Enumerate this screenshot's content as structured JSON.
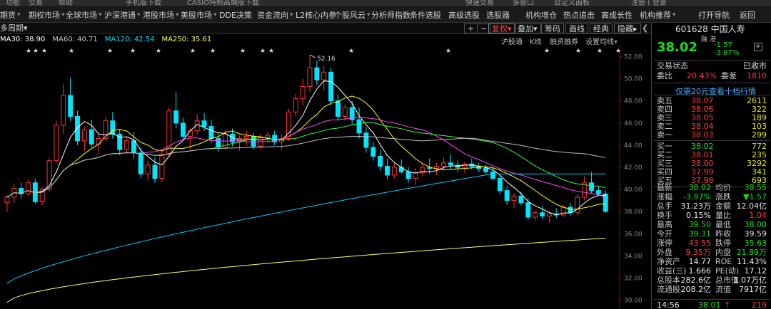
{
  "topbar": {
    "items": [
      "功能",
      "交易",
      "帮助",
      "手机版下载",
      "CASIO特制高端版下载",
      "快速交易",
      "多窗口",
      "自定义面板",
      "注册 | 登录"
    ]
  },
  "menu": {
    "items": [
      {
        "label": "期货",
        "arrow": true
      },
      {
        "label": "期权市场",
        "arrow": true
      },
      {
        "label": "全球市场",
        "arrow": true
      },
      {
        "label": "沪深港通",
        "arrow": true
      },
      {
        "label": "港股市场",
        "arrow": true
      },
      {
        "label": "美股市场",
        "arrow": true
      },
      {
        "label": "DDE决策",
        "arrow": false
      },
      {
        "label": "资金流向",
        "arrow": true
      },
      {
        "label": "L2核心内参",
        "arrow": false
      },
      {
        "label": "个股风云",
        "arrow": true
      },
      {
        "label": "分析师指数",
        "arrow": false
      },
      {
        "label": "条件选股",
        "arrow": false
      },
      {
        "label": "高级选股",
        "arrow": false
      },
      {
        "label": "选股器",
        "arrow": false
      },
      {
        "label": "机构增仓",
        "arrow": false
      },
      {
        "label": "热点追击",
        "arrow": false
      },
      {
        "label": "高成长性",
        "arrow": false
      },
      {
        "label": "机构推荐",
        "arrow": true
      },
      {
        "label": "打开导航",
        "arrow": false
      },
      {
        "label": "返回",
        "arrow": false
      }
    ]
  },
  "toolbar": {
    "period": "多周期",
    "period_arrow": "▾",
    "plus": "+",
    "minus": "−",
    "fq_label": "复权",
    "stack_label": "叠加",
    "chip_label": "筹码",
    "draw_label": "画线",
    "classic_label": "经典",
    "hide_label": "隐藏"
  },
  "subtabs": [
    "沪股通",
    "K线",
    "融资融券",
    "设置均线"
  ],
  "ma_legend": {
    "items": [
      {
        "label": "MA30: 38.90",
        "color": "#ffffff"
      },
      {
        "label": "MA60: 40.71",
        "color": "#c8c8c8"
      },
      {
        "label": "MA120: 42.54",
        "color": "#00e5ff"
      },
      {
        "label": "MA250: 35.61",
        "color": "#ffff66"
      }
    ]
  },
  "chart_data": {
    "type": "candlestick",
    "y_ticks": [
      "52.00",
      "50.00",
      "48.00",
      "46.00",
      "44.00",
      "42.00",
      "40.00",
      "38.00",
      "36.00",
      "34.00",
      "32.00",
      "30.00"
    ],
    "ylim": [
      29.2,
      53.0
    ],
    "high_annotation": "52.16",
    "candles": [
      [
        38.8,
        39.5,
        38.0,
        39.3
      ],
      [
        39.3,
        40.5,
        38.8,
        40.1
      ],
      [
        40.1,
        40.6,
        39.2,
        39.6
      ],
      [
        39.6,
        40.9,
        39.4,
        40.6
      ],
      [
        40.6,
        41.0,
        38.7,
        38.9
      ],
      [
        38.9,
        40.2,
        38.6,
        40.0
      ],
      [
        40.0,
        42.8,
        39.8,
        42.6
      ],
      [
        42.6,
        46.2,
        42.4,
        45.8
      ],
      [
        45.8,
        49.5,
        45.0,
        48.5
      ],
      [
        48.5,
        50.1,
        46.2,
        46.6
      ],
      [
        46.6,
        47.1,
        44.0,
        44.4
      ],
      [
        44.4,
        45.7,
        43.5,
        45.4
      ],
      [
        45.4,
        46.3,
        43.8,
        44.1
      ],
      [
        44.1,
        45.0,
        43.2,
        44.6
      ],
      [
        44.6,
        46.5,
        44.4,
        46.2
      ],
      [
        46.2,
        47.0,
        44.6,
        45.0
      ],
      [
        45.0,
        45.4,
        43.1,
        43.6
      ],
      [
        43.6,
        44.8,
        43.2,
        44.4
      ],
      [
        44.4,
        45.2,
        42.8,
        43.3
      ],
      [
        43.3,
        43.8,
        41.0,
        41.4
      ],
      [
        41.4,
        42.6,
        40.8,
        42.2
      ],
      [
        42.2,
        42.9,
        40.6,
        41.0
      ],
      [
        41.0,
        43.5,
        40.7,
        43.2
      ],
      [
        43.2,
        47.4,
        43.0,
        47.1
      ],
      [
        47.1,
        48.8,
        45.5,
        46.0
      ],
      [
        46.0,
        46.5,
        44.4,
        44.8
      ],
      [
        44.8,
        45.6,
        43.6,
        45.3
      ],
      [
        45.3,
        46.8,
        44.9,
        46.2
      ],
      [
        46.2,
        46.9,
        45.3,
        45.7
      ],
      [
        45.7,
        46.3,
        44.2,
        44.6
      ],
      [
        44.6,
        45.2,
        43.4,
        43.8
      ],
      [
        43.8,
        45.4,
        43.6,
        45.0
      ],
      [
        45.0,
        45.5,
        43.9,
        44.3
      ],
      [
        44.3,
        44.9,
        43.5,
        44.6
      ],
      [
        44.6,
        45.3,
        44.0,
        44.8
      ],
      [
        44.8,
        45.1,
        43.6,
        43.9
      ],
      [
        43.9,
        45.0,
        43.7,
        44.7
      ],
      [
        44.7,
        45.2,
        44.2,
        44.9
      ],
      [
        44.9,
        45.3,
        44.0,
        44.3
      ],
      [
        44.3,
        45.0,
        43.6,
        44.6
      ],
      [
        44.6,
        47.3,
        44.4,
        47.0
      ],
      [
        47.0,
        48.6,
        46.6,
        48.2
      ],
      [
        48.2,
        50.0,
        47.6,
        49.3
      ],
      [
        49.3,
        52.16,
        48.8,
        51.0
      ],
      [
        51.0,
        51.6,
        49.4,
        49.9
      ],
      [
        49.9,
        51.2,
        48.9,
        50.6
      ],
      [
        50.6,
        51.0,
        47.6,
        48.0
      ],
      [
        48.0,
        48.5,
        46.2,
        46.6
      ],
      [
        46.6,
        47.7,
        46.2,
        47.4
      ],
      [
        47.4,
        48.0,
        45.9,
        46.3
      ],
      [
        46.3,
        47.4,
        44.6,
        45.1
      ],
      [
        45.1,
        45.6,
        43.3,
        43.8
      ],
      [
        43.8,
        44.3,
        42.6,
        43.0
      ],
      [
        43.0,
        43.6,
        41.7,
        42.1
      ],
      [
        42.1,
        42.8,
        40.9,
        41.3
      ],
      [
        41.3,
        42.4,
        41.0,
        42.0
      ],
      [
        42.0,
        42.7,
        41.4,
        41.6
      ],
      [
        41.6,
        42.0,
        40.6,
        41.0
      ],
      [
        41.0,
        41.9,
        40.4,
        41.5
      ],
      [
        41.5,
        42.3,
        41.2,
        42.0
      ],
      [
        42.0,
        42.8,
        41.4,
        41.9
      ],
      [
        41.9,
        42.4,
        41.3,
        42.1
      ],
      [
        42.1,
        42.9,
        41.7,
        42.4
      ],
      [
        42.4,
        43.2,
        41.8,
        42.2
      ],
      [
        42.2,
        42.6,
        41.6,
        42.0
      ],
      [
        42.0,
        42.5,
        41.5,
        42.3
      ],
      [
        42.3,
        42.8,
        41.8,
        42.1
      ],
      [
        42.1,
        42.4,
        41.6,
        41.9
      ],
      [
        41.9,
        42.2,
        41.4,
        41.6
      ],
      [
        41.6,
        42.0,
        40.8,
        41.0
      ],
      [
        41.0,
        41.2,
        39.6,
        39.9
      ],
      [
        39.9,
        40.3,
        38.6,
        39.0
      ],
      [
        39.0,
        39.7,
        38.3,
        39.4
      ],
      [
        39.4,
        39.8,
        38.6,
        38.8
      ],
      [
        38.8,
        39.2,
        37.3,
        37.5
      ],
      [
        37.5,
        38.1,
        37.2,
        37.9
      ],
      [
        37.9,
        38.5,
        37.3,
        37.6
      ],
      [
        37.6,
        38.0,
        37.0,
        37.8
      ],
      [
        37.8,
        38.3,
        37.4,
        37.7
      ],
      [
        37.7,
        38.6,
        37.5,
        38.4
      ],
      [
        38.4,
        38.8,
        37.6,
        37.9
      ],
      [
        37.9,
        39.6,
        37.7,
        39.3
      ],
      [
        39.3,
        41.2,
        39.0,
        40.6
      ],
      [
        40.6,
        41.6,
        39.6,
        39.9
      ],
      [
        39.9,
        40.3,
        39.5,
        39.6
      ],
      [
        39.6,
        39.9,
        37.9,
        38.02
      ]
    ],
    "star_markers": [
      "★",
      "★",
      "★",
      "★",
      "★",
      "★",
      "★",
      "★",
      "★",
      "★",
      "★",
      "★",
      "★",
      "★",
      "★",
      "★",
      "★",
      "★"
    ]
  },
  "quote": {
    "code": "601628",
    "name": "中国人寿",
    "tag1": "融",
    "tag2": "港",
    "price": "38.02",
    "change": "-1.57",
    "change_pct": "-3.97%",
    "plus": "+",
    "status_label": "交易状态",
    "status_value": "已收市",
    "weibi_label": "委比",
    "weibi_value": "20.43%",
    "weicha_label": "委差",
    "weicha_value": "1810",
    "link": "仅需20元查看十档行情",
    "asks": [
      {
        "label": "卖五",
        "price": "38.07",
        "vol": "2611"
      },
      {
        "label": "卖四",
        "price": "38.06",
        "vol": "322"
      },
      {
        "label": "卖三",
        "price": "38.05",
        "vol": "189"
      },
      {
        "label": "卖二",
        "price": "38.04",
        "vol": "103"
      },
      {
        "label": "卖一",
        "price": "38.03",
        "vol": "299"
      }
    ],
    "bids": [
      {
        "label": "买一",
        "price": "38.02",
        "vol": "772"
      },
      {
        "label": "买二",
        "price": "38.01",
        "vol": "235"
      },
      {
        "label": "买三",
        "price": "38.00",
        "vol": "3292"
      },
      {
        "label": "买四",
        "price": "37.99",
        "vol": "341"
      },
      {
        "label": "买五",
        "price": "37.98",
        "vol": "693"
      }
    ],
    "stats": [
      {
        "l1": "最新",
        "v1": "38.02",
        "c1": "green",
        "l2": "均价",
        "v2": "38.55",
        "c2": "green"
      },
      {
        "l1": "涨幅",
        "v1": "-3.97%",
        "c1": "green",
        "l2": "涨跌",
        "v2": "▼1.57",
        "c2": "green"
      },
      {
        "l1": "总手",
        "v1": "31.23万",
        "c1": "wht",
        "l2": "金额",
        "v2": "12.04亿",
        "c2": "wht"
      },
      {
        "l1": "换手",
        "v1": "0.15%",
        "c1": "wht",
        "l2": "量比",
        "v2": "1.04",
        "c2": "red"
      },
      {
        "l1": "最高",
        "v1": "39.50",
        "c1": "green",
        "l2": "最低",
        "v2": "38.00",
        "c2": "green"
      },
      {
        "l1": "今开",
        "v1": "39.31",
        "c1": "green",
        "l2": "昨收",
        "v2": "39.59",
        "c2": "wht"
      },
      {
        "l1": "涨停",
        "v1": "43.55",
        "c1": "red",
        "l2": "跌停",
        "v2": "35.63",
        "c2": "green"
      },
      {
        "l1": "外盘",
        "v1": "9.35万",
        "c1": "red",
        "l2": "内盘",
        "v2": "21.89万",
        "c2": "green"
      },
      {
        "l1": "净资产",
        "v1": "14.77",
        "c1": "wht",
        "l2": "ROE",
        "v2": "11.43%",
        "c2": "wht"
      },
      {
        "l1": "收益(三)",
        "v1": "1.666",
        "c1": "wht",
        "l2": "PE(动)",
        "v2": "17.12",
        "c2": "wht"
      },
      {
        "l1": "总股本",
        "v1": "282.6亿",
        "c1": "wht",
        "l2": "总市值",
        "v2": "1.07万亿",
        "c2": "wht"
      },
      {
        "l1": "流通股",
        "v1": "208.2亿",
        "c1": "wht",
        "l2": "流值",
        "v2": "7917亿",
        "c2": "wht"
      }
    ],
    "tick": {
      "time": "14:56",
      "price": "38.01",
      "arrow": "↑",
      "vol": "219"
    }
  }
}
